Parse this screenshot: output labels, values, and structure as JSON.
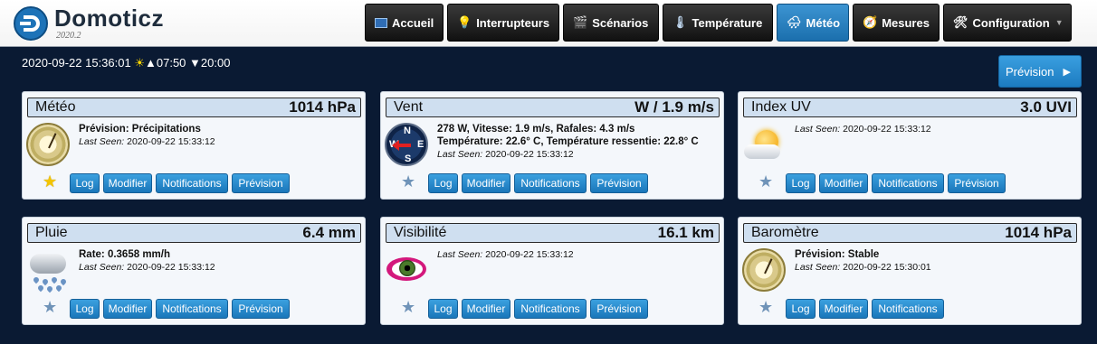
{
  "app": {
    "name": "Domoticz",
    "version": "2020.2"
  },
  "nav": [
    {
      "label": "Accueil",
      "icon": "home-icon",
      "active": false
    },
    {
      "label": "Interrupteurs",
      "icon": "lightbulb-icon",
      "active": false
    },
    {
      "label": "Scénarios",
      "icon": "clapperboard-icon",
      "active": false
    },
    {
      "label": "Température",
      "icon": "thermometer-icon",
      "active": false
    },
    {
      "label": "Météo",
      "icon": "weather-icon",
      "active": true
    },
    {
      "label": "Mesures",
      "icon": "gauge-icon",
      "active": false
    },
    {
      "label": "Configuration",
      "icon": "tools-icon",
      "active": false
    }
  ],
  "status": {
    "datetime": "2020-09-22 15:36:01",
    "sunrise": "▲07:50",
    "sunset": "▼20:00"
  },
  "prevision_button": "Prévision",
  "buttons": {
    "log": "Log",
    "modify": "Modifier",
    "notifications": "Notifications",
    "forecast": "Prévision"
  },
  "cards": [
    {
      "name": "Météo",
      "value": "1014 hPa",
      "lines": [
        "Prévision: Précipitations"
      ],
      "last_seen_label": "Last Seen:",
      "last_seen": "2020-09-22 15:33:12",
      "favorite": true,
      "icon": "barometer-icon",
      "has_forecast": true
    },
    {
      "name": "Vent",
      "value": "W / 1.9 m/s",
      "lines": [
        "278 W, Vitesse: 1.9 m/s, Rafales: 4.3 m/s",
        "Température: 22.6° C, Température ressentie: 22.8° C"
      ],
      "last_seen_label": "Last Seen:",
      "last_seen": "2020-09-22 15:33:12",
      "favorite": false,
      "icon": "compass-icon",
      "has_forecast": true
    },
    {
      "name": "Index UV",
      "value": "3.0 UVI",
      "lines": [],
      "last_seen_label": "Last Seen:",
      "last_seen": "2020-09-22 15:33:12",
      "favorite": false,
      "icon": "sun-icon",
      "has_forecast": true
    },
    {
      "name": "Pluie",
      "value": "6.4 mm",
      "lines": [
        "Rate: 0.3658 mm/h"
      ],
      "last_seen_label": "Last Seen:",
      "last_seen": "2020-09-22 15:33:12",
      "favorite": false,
      "icon": "rain-icon",
      "has_forecast": true
    },
    {
      "name": "Visibilité",
      "value": "16.1 km",
      "lines": [],
      "last_seen_label": "Last Seen:",
      "last_seen": "2020-09-22 15:33:12",
      "favorite": false,
      "icon": "eye-icon",
      "has_forecast": true
    },
    {
      "name": "Baromètre",
      "value": "1014 hPa",
      "lines": [
        "Prévision: Stable"
      ],
      "last_seen_label": "Last Seen:",
      "last_seen": "2020-09-22 15:30:01",
      "favorite": false,
      "icon": "barometer-icon",
      "has_forecast": false
    }
  ]
}
